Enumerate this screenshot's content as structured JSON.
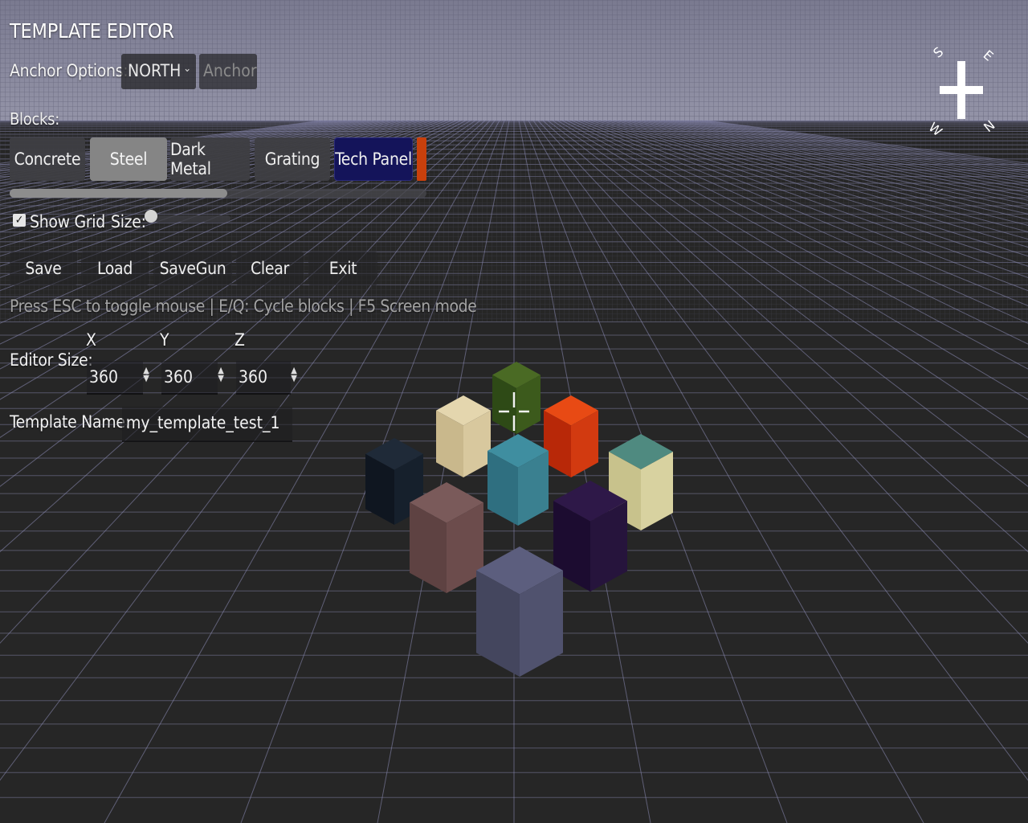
{
  "editor": {
    "title": "TEMPLATE EDITOR",
    "anchor_label": "Anchor Options:",
    "anchor_value": "NORTH",
    "anchor_button": "Anchor",
    "blocks_label": "Blocks:",
    "blocks": [
      "Concrete",
      "Steel",
      "Dark Metal",
      "Grating",
      "Tech Panel"
    ],
    "selected_block": "Steel",
    "show_grid_label": "Show Grid",
    "show_grid_checked": true,
    "size_label": "Size:",
    "actions": [
      "Save",
      "Load",
      "SaveGun",
      "Clear",
      "Exit"
    ],
    "hint": "Press ESC to toggle mouse | E/Q: Cycle blocks | F5 Screen mode",
    "editor_size_label": "Editor Size:",
    "axis_x": "X",
    "axis_y": "Y",
    "axis_z": "Z",
    "size_x": "360",
    "size_y": "360",
    "size_z": "360",
    "template_name_label": "Template Name:",
    "template_name": "my_template_test_1"
  },
  "compass": {
    "letters": [
      "S",
      "E",
      "N",
      "W"
    ]
  },
  "scene": {
    "sky_color": "#8a8aa0",
    "floor_color": "#232323",
    "grid_color": "#8e8eb8",
    "blocks": [
      {
        "name": "obsidian",
        "top": "#1f2a38",
        "left": "#0f1620",
        "right": "#16202c"
      },
      {
        "name": "end-stone",
        "top": "#e4d6ae",
        "left": "#c9b88c",
        "right": "#d8c89e"
      },
      {
        "name": "leaves",
        "top": "#4a6a24",
        "left": "#2e4a16",
        "right": "#3c5a1c"
      },
      {
        "name": "magma",
        "top": "#e84a14",
        "left": "#b82808",
        "right": "#d23a10"
      },
      {
        "name": "prismarine",
        "top": "#3f8ea0",
        "left": "#2f6f80",
        "right": "#3a8090"
      },
      {
        "name": "glazed-terracotta",
        "top": "#4f8a80",
        "left": "#c8c28c",
        "right": "#d8d2a0"
      },
      {
        "name": "terracotta",
        "top": "#7a5a5a",
        "left": "#5e4242",
        "right": "#6c4c4c"
      },
      {
        "name": "purple-block",
        "top": "#2e1848",
        "left": "#1c0c30",
        "right": "#26143c"
      },
      {
        "name": "blue-concrete",
        "top": "#5c5e7e",
        "left": "#44465e",
        "right": "#50526e"
      }
    ]
  }
}
